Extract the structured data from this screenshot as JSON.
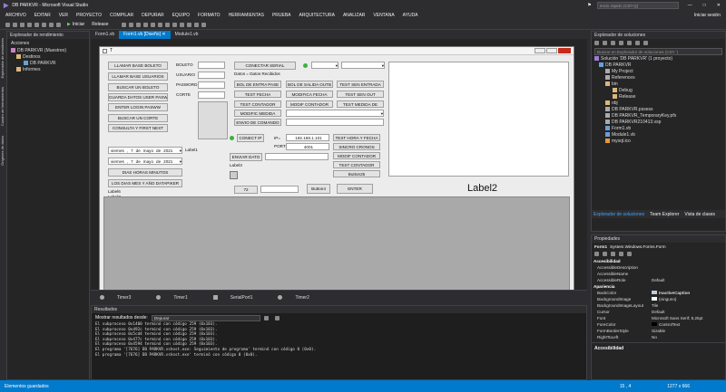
{
  "window": {
    "title": "DB PARKVR - Microsoft Visual Studio",
    "quick_launch": "Inicio rápido (Ctrl+Q)",
    "signin": "Iniciar sesión"
  },
  "menu": [
    "ARCHIVO",
    "EDITAR",
    "VER",
    "PROYECTO",
    "COMPILAR",
    "DEPURAR",
    "EQUIPO",
    "FORMATO",
    "HERRAMIENTAS",
    "PRUEBA",
    "ARQUITECTURA",
    "ANALIZAR",
    "VENTANA",
    "AYUDA"
  ],
  "toolbar": {
    "start": "Iniciar",
    "config": "Release"
  },
  "left_rail": [
    "Explorador de servidores",
    "Cuadro de herramientas",
    "Orígenes de datos"
  ],
  "perf_explorer": {
    "title": "Explorador de rendimiento",
    "actions": "Acciones",
    "tree": [
      "DB PARKVR (Muestreo)",
      "Destinos",
      "DB PARKVR",
      "Informes"
    ]
  },
  "tabs": [
    "Form1.vb",
    "Form1.vb [Diseño]",
    "Module1.vb"
  ],
  "form": {
    "title": "T",
    "buttons_left": [
      "LLAMAR BASE BOLETO",
      "LLAMAR BASE USUARIOS",
      "BUSCAR UN BOLETO",
      "GUARDA DATOS USER PASW",
      "ENTER LOGIN PASWW",
      "BUSCAR UN CORTE",
      "CONSULTA Y FIRST NEXT"
    ],
    "labels_login": [
      "BOLETO",
      "USUARIO",
      "PASWORD",
      "CORTE"
    ],
    "date1": {
      "day": "viernes",
      "num": "7",
      "de1": "de",
      "month": "mayo",
      "de2": "de",
      "year": "2021"
    },
    "date2": {
      "day": "viernes",
      "num": "7",
      "de1": "de",
      "month": "mayo",
      "de2": "de",
      "year": "2021"
    },
    "label1": "Label1",
    "dias_btn": "DIAS HORAS MINUTOS",
    "datapicker_btn": "LOS DIAS MES Y AÑO DATAPIKER",
    "label6": "Label6",
    "label7": "Label7",
    "serial": {
      "connect": "CONECTAR SERIAL",
      "datos": "Datos = Datos Recibidos"
    },
    "mid_buttons": [
      "BOL DE ENTRA PASE",
      "TEST FECHA",
      "TEST CONTADOR",
      "MODIFIC MEDIDA",
      "ENVIO DE COMANDO"
    ],
    "mid_buttons2": [
      "BOL DE SALIDA OUTB",
      "MODIFICA FECHA",
      "MODIF CONTADOR"
    ],
    "right_buttons": [
      "TEST SEN ENTRADA",
      "TEST SEN OUT",
      "TEST MEDIDA DE"
    ],
    "net": {
      "connect_ip": "CONECT IP",
      "ip_label": "IP=",
      "ip_value": "192.168.1.101",
      "port_label": "PORT=",
      "port_value": "4001",
      "send": "ENVIAR DATO",
      "label3": "Label3"
    },
    "net_buttons": [
      "TEST HORA Y FECHA",
      "SINCRO CRONOS",
      "MODIF CONTADOR",
      "TEST CONTADOR",
      "Button25"
    ],
    "btn_72": "72",
    "button4": "Button4",
    "enter": "ENTER",
    "label2": "Label2"
  },
  "component_tray": [
    "Timer3",
    "Timer1",
    "SerialPort1",
    "Timer2"
  ],
  "output": {
    "title": "Resultados",
    "show_from": "Mostrar resultados desde:",
    "source": "Depurar",
    "lines": [
      "El subproceso 0x1400 terminó con código 259 (0x103).",
      "El subproceso 0x492c terminó con código 259 (0x103).",
      "El subproceso 0x5cd4 terminó con código 259 (0x103).",
      "El subproceso 0x477c terminó con código 259 (0x103).",
      "El subproceso 0x4594 terminó con código 259 (0x103).",
      "El programa '[7676] DB PARKVR.vshost.exe: Seguimiento de programa' terminó con código 0 (0x0).",
      "El programa '[7676] DB PARKVR.vshost.exe' terminó con código 0 (0x0)."
    ]
  },
  "solution_explorer": {
    "title": "Explorador de soluciones",
    "search": "Buscar en Explorador de soluciones (Ctrl+´)",
    "tree": [
      "Solución 'DB PARKVR' (1 proyecto)",
      "DB PARKVR",
      "My Project",
      "References",
      "bin",
      "Debug",
      "Release",
      "obj",
      "DB PARKVR.pssess",
      "DB PARKVR_TemporaryKey.pfx",
      "DB PARKVR210413.vsp",
      "Form1.vb",
      "Module1.vb",
      "mysql.ico"
    ],
    "tabs": [
      "Explorador de soluciones",
      "Team Explorer",
      "Vista de clases"
    ]
  },
  "properties": {
    "title": "Propiedades",
    "object": "Form1",
    "object_type": "System.Windows.Forms.Form",
    "rows": [
      {
        "k": "Accesibilidad",
        "v": "",
        "cat": true
      },
      {
        "k": "AccessibleDescription",
        "v": ""
      },
      {
        "k": "AccessibleName",
        "v": ""
      },
      {
        "k": "AccessibleRole",
        "v": "Default"
      },
      {
        "k": "Apariencia",
        "v": "",
        "cat": true
      },
      {
        "k": "BackColor",
        "v": "InactiveCaption"
      },
      {
        "k": "BackgroundImage",
        "v": "(ninguno)"
      },
      {
        "k": "BackgroundImageLayout",
        "v": "Tile"
      },
      {
        "k": "Cursor",
        "v": "Default"
      },
      {
        "k": "Font",
        "v": "Microsoft Sans Serif; 8,25pt"
      },
      {
        "k": "ForeColor",
        "v": "ControlText"
      },
      {
        "k": "FormBorderStyle",
        "v": "Sizable"
      },
      {
        "k": "RightToLeft",
        "v": "No"
      }
    ],
    "footer": "Accesibilidad"
  },
  "status": {
    "left": "Elementos guardados",
    "pos": "15 , 4",
    "size": "1277 x 666"
  },
  "colors": {
    "accent": "#007acc",
    "bg": "#2d2d30"
  }
}
